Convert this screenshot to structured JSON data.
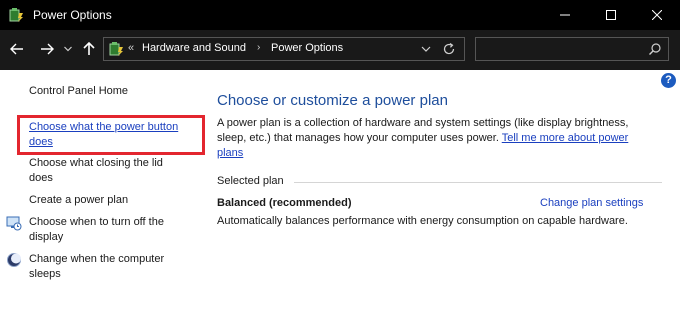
{
  "window": {
    "title": "Power Options"
  },
  "address_bar": {
    "overflow": "«",
    "crumbs": [
      "Hardware and Sound",
      "Power Options"
    ],
    "separator": "›"
  },
  "sidebar": {
    "home": "Control Panel Home",
    "items": [
      {
        "label": "Choose what the power button does",
        "highlighted": true
      },
      {
        "label": "Choose what closing the lid does"
      },
      {
        "label": "Create a power plan"
      },
      {
        "label": "Choose when to turn off the display",
        "icon": "monitor-clock-icon"
      },
      {
        "label": "Change when the computer sleeps",
        "icon": "moon-icon"
      }
    ]
  },
  "main": {
    "title": "Choose or customize a power plan",
    "description": "A power plan is a collection of hardware and system settings (like display brightness, sleep, etc.) that manages how your computer uses power.",
    "tell_more_link": "Tell me more about power plans",
    "selected_plan_heading": "Selected plan",
    "plan": {
      "name": "Balanced (recommended)",
      "change_link": "Change plan settings",
      "description": "Automatically balances performance with energy consumption on capable hardware."
    }
  },
  "help": {
    "label": "?"
  },
  "colors": {
    "titlebar": "#000000",
    "addressbar": "#191919",
    "link": "#1a3fbf",
    "heading": "#1e4e9c",
    "highlight": "#e3262f"
  }
}
